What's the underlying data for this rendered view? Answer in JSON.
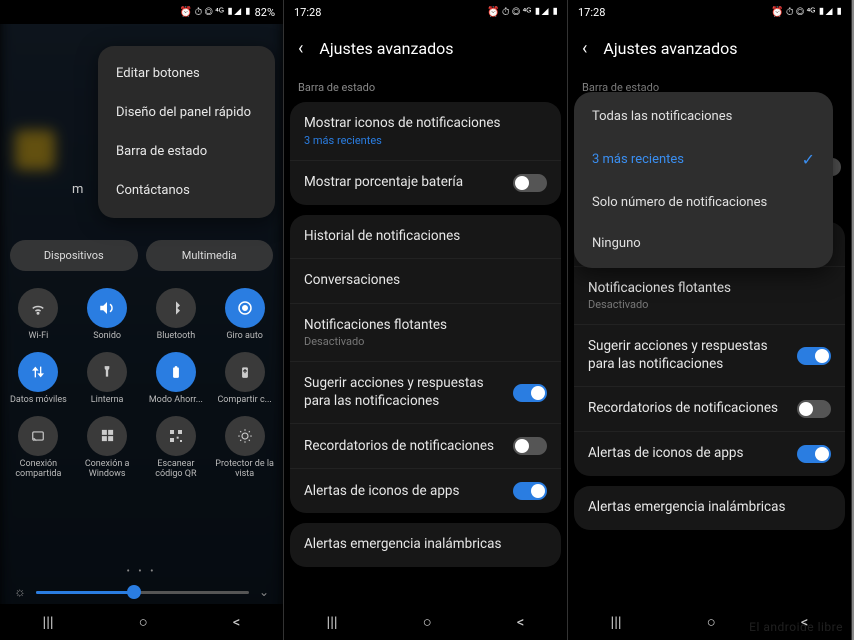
{
  "status": {
    "time": "17:28",
    "battery_pct": "82%",
    "icons": "⏰ ⏱ ◎ ⁴ᴳ ▮◢ ▮"
  },
  "screen1": {
    "menu": [
      "Editar botones",
      "Diseño del panel rápido",
      "Barra de estado",
      "Contáctanos"
    ],
    "m": "m",
    "pills": [
      "Dispositivos",
      "Multimedia"
    ],
    "tiles": [
      {
        "icon": "wifi",
        "label": "Wi-Fi",
        "active": false
      },
      {
        "icon": "sound",
        "label": "Sonido",
        "active": true
      },
      {
        "icon": "bluetooth",
        "label": "Bluetooth",
        "active": false
      },
      {
        "icon": "rotate",
        "label": "Giro auto",
        "active": true
      },
      {
        "icon": "data",
        "label": "Datos móviles",
        "active": true
      },
      {
        "icon": "flash",
        "label": "Linterna",
        "active": false
      },
      {
        "icon": "battery",
        "label": "Modo Ahorr...",
        "active": true
      },
      {
        "icon": "share",
        "label": "Compartir c...",
        "active": false
      },
      {
        "icon": "cast",
        "label": "Conexión compartida",
        "active": false
      },
      {
        "icon": "windows",
        "label": "Conexión a Windows",
        "active": false
      },
      {
        "icon": "qr",
        "label": "Escanear código QR",
        "active": false
      },
      {
        "icon": "eye",
        "label": "Protector de la vista",
        "active": false
      }
    ]
  },
  "settings": {
    "header": "Ajustes avanzados",
    "section": "Barra de estado",
    "rows": {
      "show_icons": {
        "title": "Mostrar iconos de notificaciones",
        "sub": "3 más recientes"
      },
      "battery_pct": {
        "title": "Mostrar porcentaje batería"
      },
      "history": {
        "title": "Historial de notificaciones"
      },
      "conversations": {
        "title": "Conversaciones"
      },
      "floating": {
        "title": "Notificaciones flotantes",
        "sub": "Desactivado"
      },
      "suggest": {
        "title": "Sugerir acciones y respuestas para las notificaciones"
      },
      "reminders": {
        "title": "Recordatorios de notificaciones"
      },
      "app_alerts": {
        "title": "Alertas de iconos de apps"
      },
      "wireless": {
        "title": "Alertas emergencia inalámbricas"
      }
    }
  },
  "dropdown": {
    "options": [
      "Todas las notificaciones",
      "3 más recientes",
      "Solo número de notificaciones",
      "Ninguno"
    ],
    "selected_index": 1
  },
  "watermark": "El androide libre"
}
